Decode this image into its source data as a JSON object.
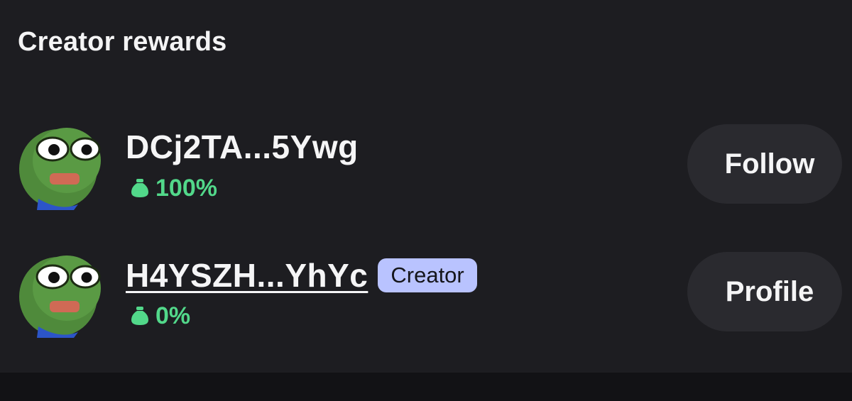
{
  "section": {
    "title": "Creator rewards"
  },
  "colors": {
    "background": "#1d1d21",
    "reward_green": "#52d88a",
    "badge_bg": "#b9c3ff",
    "button_bg": "#2a2a2f"
  },
  "rows": [
    {
      "avatar_icon": "pepe-frog-avatar",
      "name": "DCj2TA...5Ywg",
      "badge": null,
      "reward_icon": "money-bag-icon",
      "reward_percent": "100%",
      "action_label": "Follow"
    },
    {
      "avatar_icon": "pepe-frog-avatar",
      "name": "H4YSZH...YhYc",
      "badge": "Creator",
      "reward_icon": "money-bag-icon",
      "reward_percent": "0%",
      "action_label": "Profile"
    }
  ]
}
